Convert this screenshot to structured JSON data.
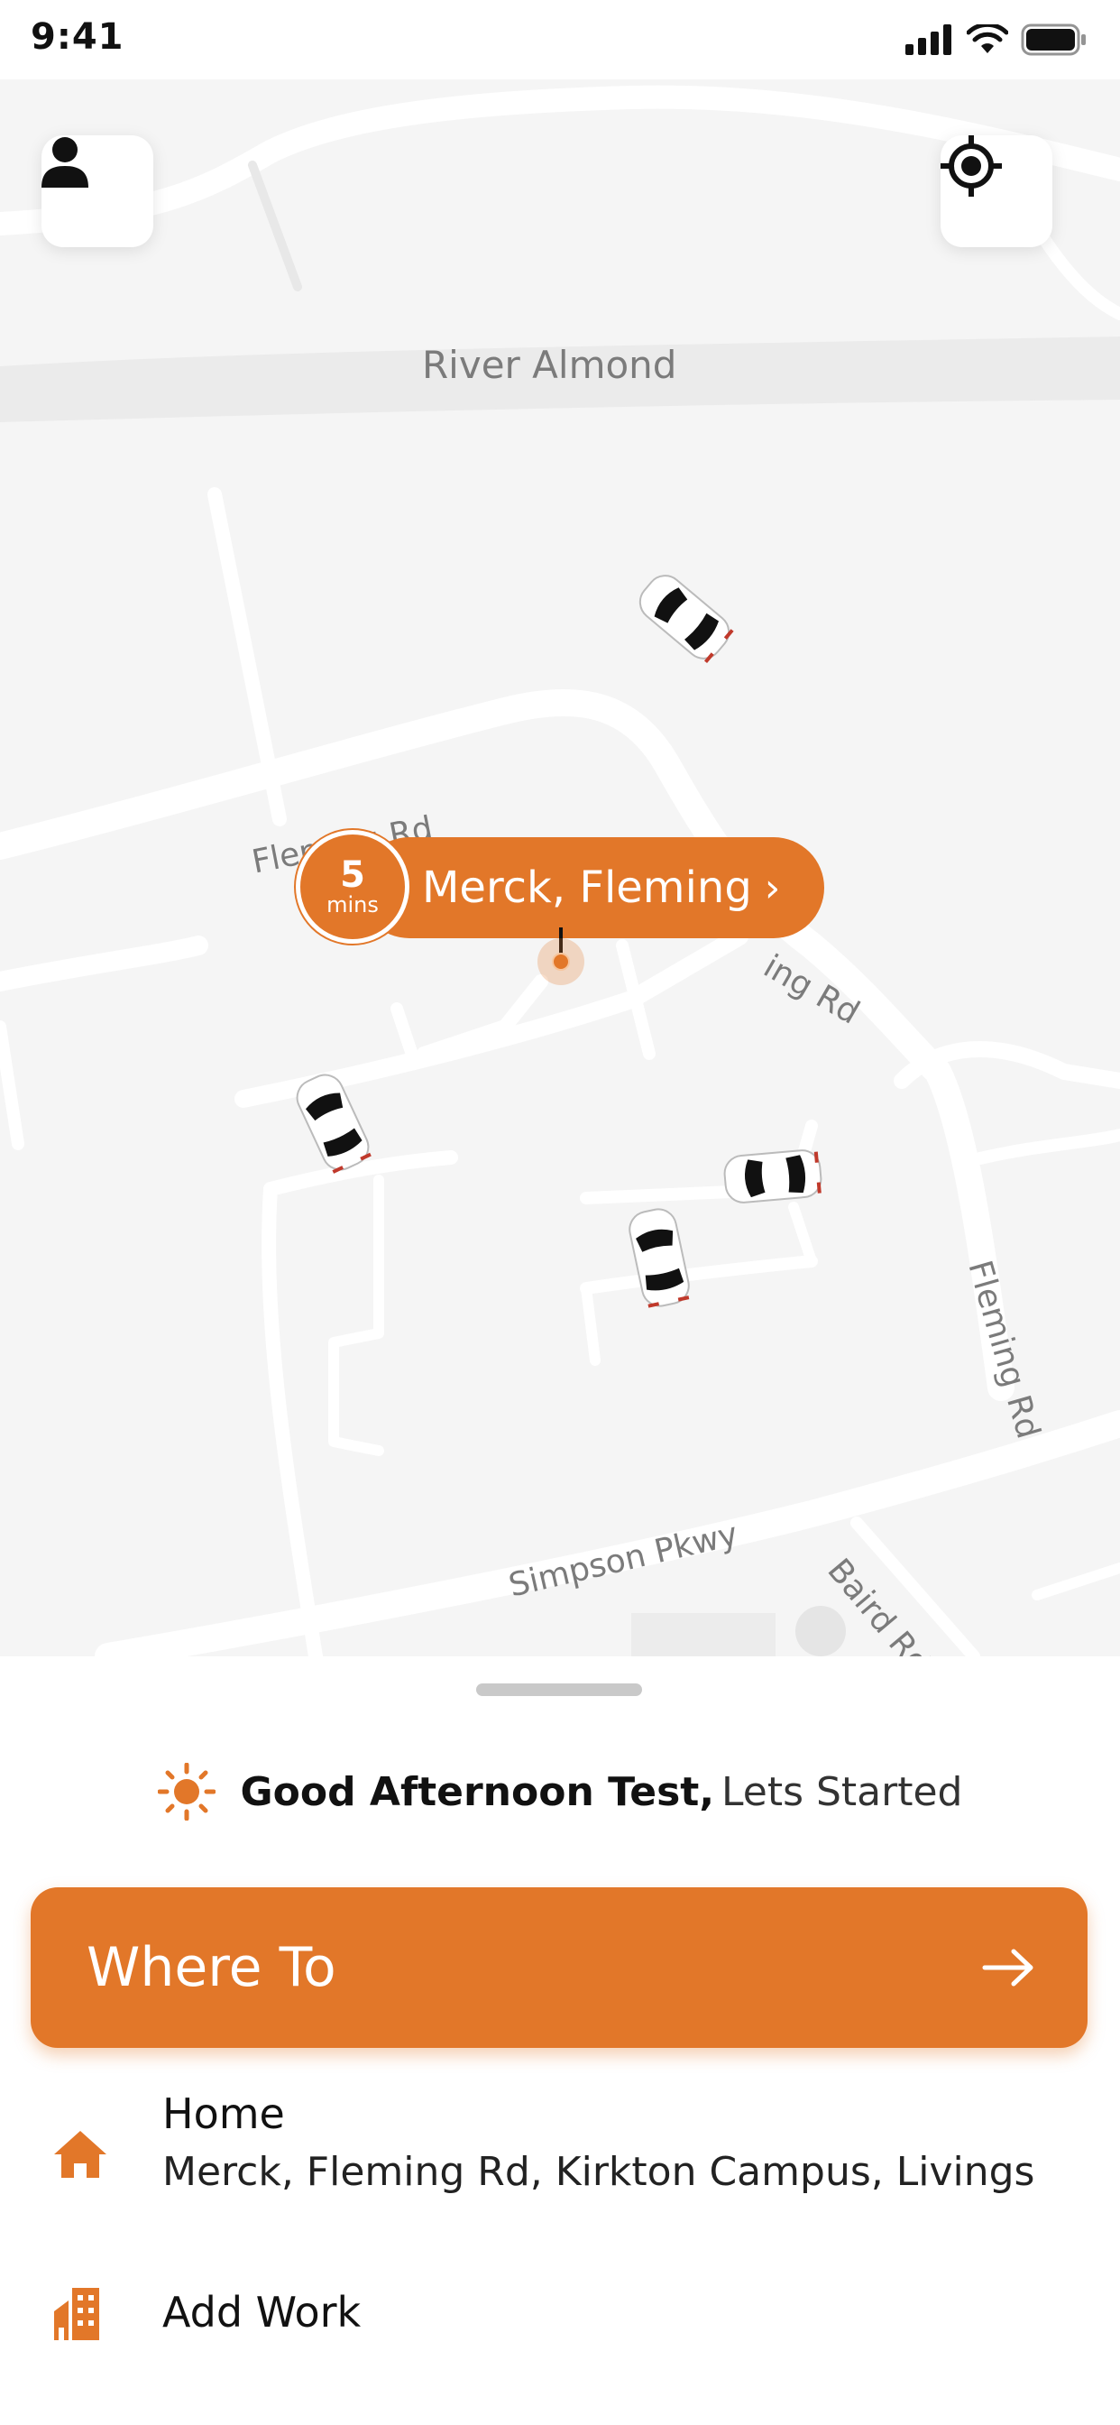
{
  "status_bar": {
    "time": "9:41"
  },
  "map": {
    "labels": {
      "river": "River Almond",
      "fleming_rd_1": "Fleming Rd",
      "fleming_rd_2": "ing Rd",
      "fleming_rd_3": "Fleming Rd",
      "simpson": "Simpson Pkwy",
      "baird": "Baird Rd"
    },
    "pickup": {
      "eta_value": "5",
      "eta_unit": "mins",
      "location": "Merck, Fleming",
      "chevron": "›"
    },
    "cars_icon": "car-icon"
  },
  "greeting": {
    "bold": "Good Afternoon Test,",
    "rest": "Lets Started",
    "icon": "sun-icon"
  },
  "where_to": {
    "label": "Where To",
    "icon": "arrow-right-icon"
  },
  "saved_places": [
    {
      "title": "Home",
      "subtitle": "Merck, Fleming Rd, Kirkton Campus, Livings",
      "icon": "home-icon"
    },
    {
      "title": "Add Work",
      "icon": "work-building-icon"
    }
  ],
  "colors": {
    "accent": "#e27729",
    "map_bg": "#f5f5f5",
    "road": "#ffffff"
  }
}
